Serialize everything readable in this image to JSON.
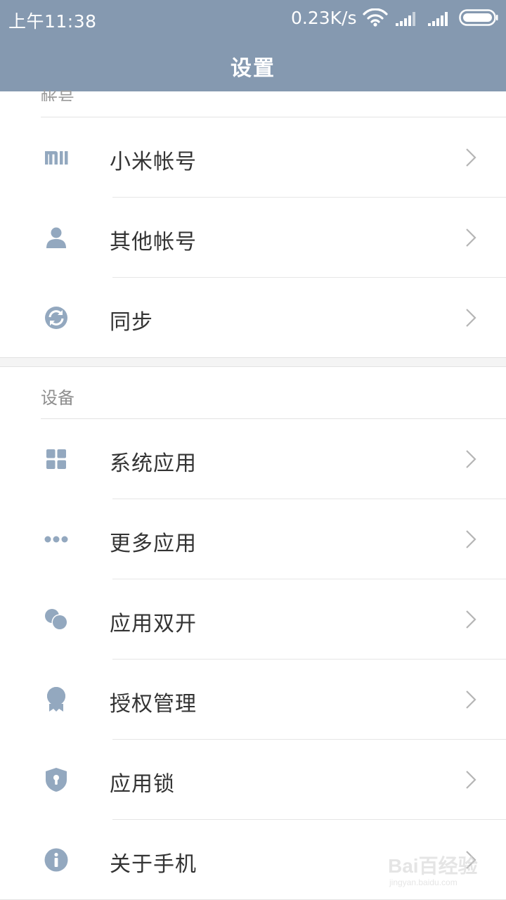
{
  "status_bar": {
    "time": "上午11:38",
    "speed": "0.23K/s",
    "icons": [
      "wifi-icon",
      "signal-icon",
      "signal-icon",
      "battery-icon"
    ]
  },
  "header": {
    "title": "设置"
  },
  "sections": [
    {
      "label": "帐号",
      "items": [
        {
          "label": "小米帐号",
          "icon": "mi-logo-icon"
        },
        {
          "label": "其他帐号",
          "icon": "person-icon"
        },
        {
          "label": "同步",
          "icon": "sync-icon"
        }
      ]
    },
    {
      "label": "设备",
      "items": [
        {
          "label": "系统应用",
          "icon": "grid-icon"
        },
        {
          "label": "更多应用",
          "icon": "more-dots-icon"
        },
        {
          "label": "应用双开",
          "icon": "dual-circles-icon"
        },
        {
          "label": "授权管理",
          "icon": "badge-icon"
        },
        {
          "label": "应用锁",
          "icon": "shield-lock-icon"
        },
        {
          "label": "关于手机",
          "icon": "info-icon"
        }
      ]
    }
  ],
  "watermark": {
    "main": "Bai百经验",
    "sub": "jingyan.baidu.com"
  },
  "colors": {
    "header_bg": "#8599b0",
    "icon": "#93a8bf",
    "label": "#333333",
    "section_label": "#8e8e8e",
    "chevron": "#b5b5b5"
  }
}
